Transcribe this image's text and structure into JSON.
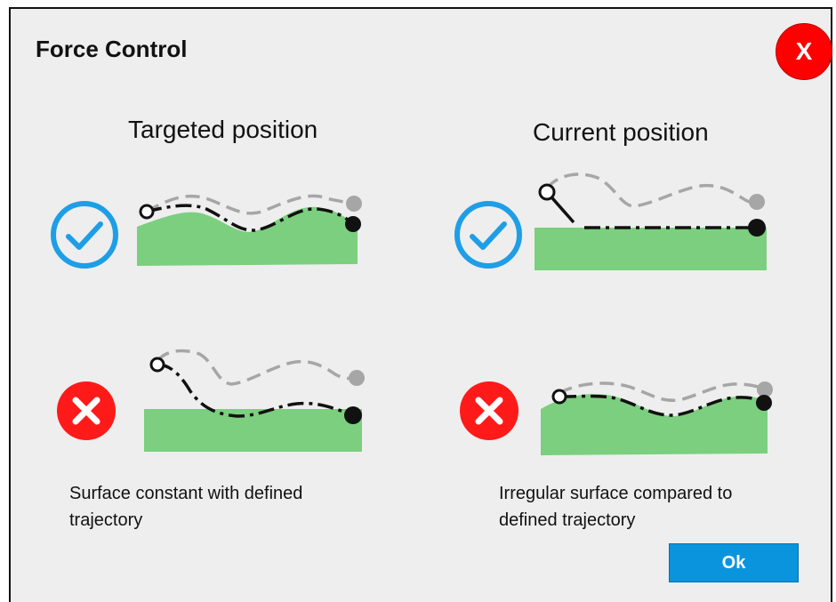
{
  "dialog": {
    "title": "Force Control",
    "close_label": "X",
    "ok_label": "Ok"
  },
  "columns": {
    "targeted": {
      "heading": "Targeted position",
      "caption": "Surface constant with defined trajectory"
    },
    "current": {
      "heading": "Current position",
      "caption": "Irregular surface compared to defined trajectory"
    }
  },
  "icons": {
    "correct": "check-circle-icon",
    "incorrect": "x-circle-icon"
  },
  "colors": {
    "surface": "#7bcf7f",
    "correct": "#1e9ee6",
    "incorrect": "#ff1a1a",
    "close_button": "#ff0000",
    "ok_button": "#0a94de",
    "defined_path": "#a6a6a6",
    "tool_path": "#000000"
  }
}
